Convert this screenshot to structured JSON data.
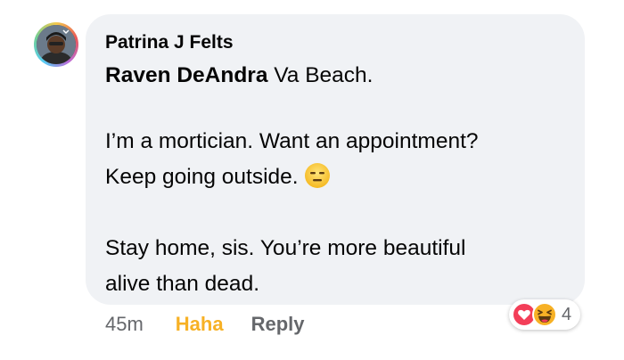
{
  "comment": {
    "author": "Patrina J Felts",
    "mention": "Raven DeAndra",
    "first_line_rest": " Va Beach.",
    "line_2": "I’m a mortician. Want an appointment?",
    "line_3": "Keep going outside.",
    "line_3_emoji": "expressionless-face-emoji",
    "line_4": "Stay home, sis. You’re more beautiful",
    "line_5": "alive than dead."
  },
  "actions": {
    "time": "45m",
    "haha_label": "Haha",
    "reply_label": "Reply"
  },
  "reactions": {
    "icons": [
      "love-icon",
      "haha-icon"
    ],
    "count": "4"
  },
  "colors": {
    "bubble": "#f0f2f5",
    "haha": "#f7b125",
    "muted": "#65676b",
    "love": "#f33e58"
  }
}
